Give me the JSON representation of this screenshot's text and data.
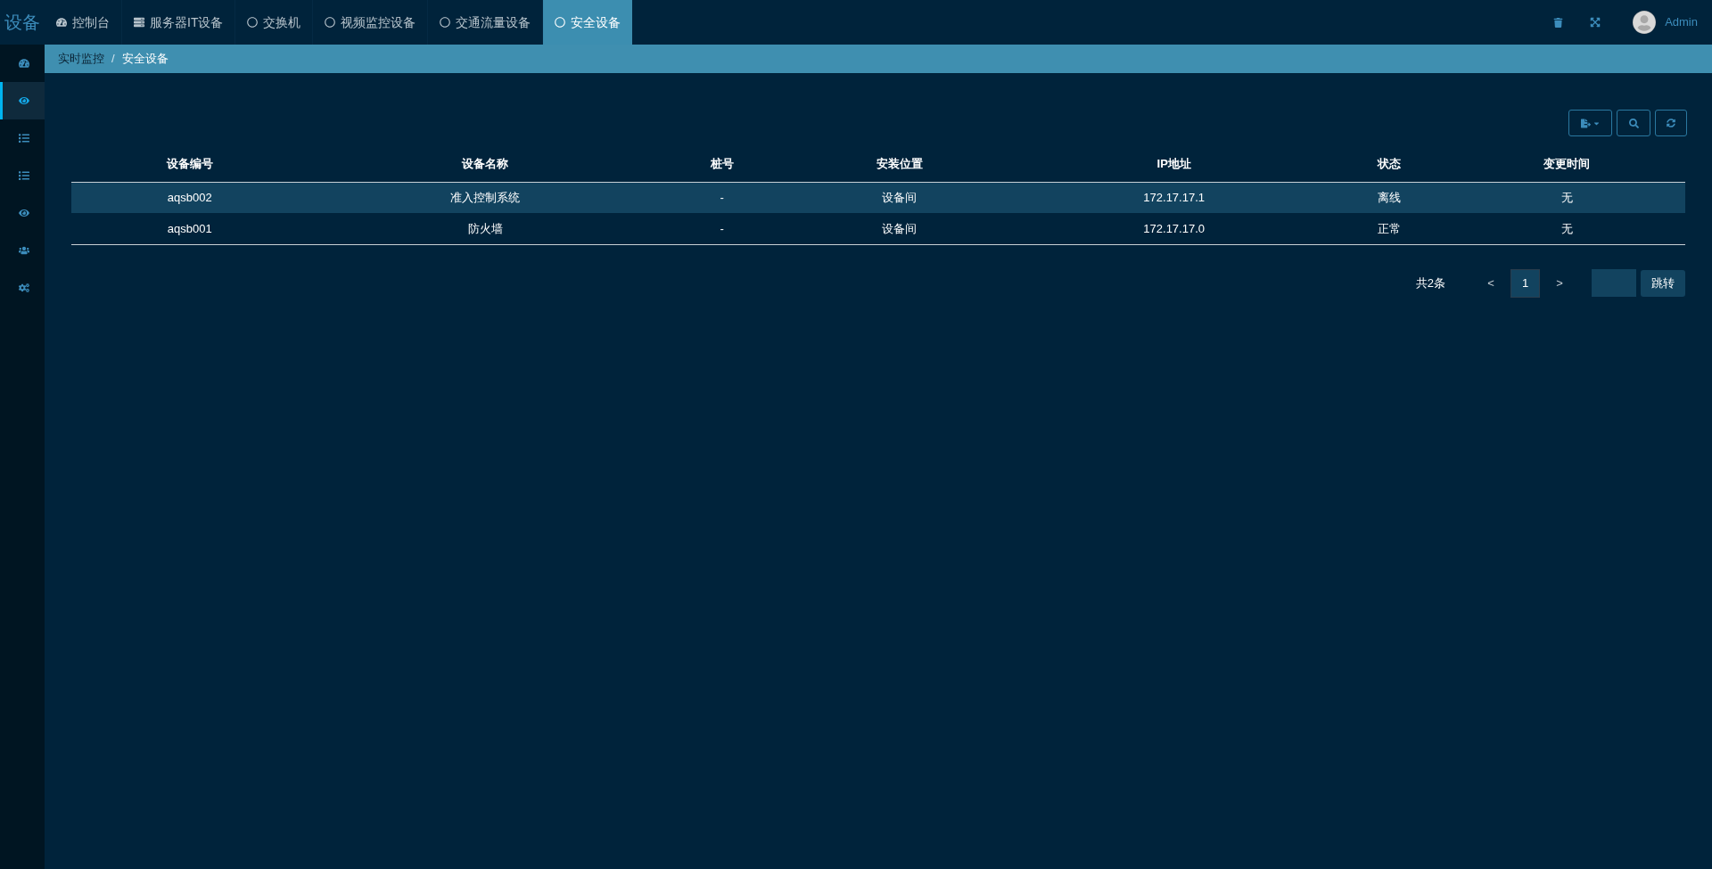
{
  "logo": "设备",
  "tabs": [
    {
      "label": "控制台",
      "kind": "dashboard",
      "selected": false
    },
    {
      "label": "服务器IT设备",
      "kind": "server",
      "selected": false
    },
    {
      "label": "交换机",
      "kind": "circle",
      "selected": false
    },
    {
      "label": "视频监控设备",
      "kind": "circle",
      "selected": false
    },
    {
      "label": "交通流量设备",
      "kind": "circle",
      "selected": false
    },
    {
      "label": "安全设备",
      "kind": "circle",
      "selected": true
    }
  ],
  "user": {
    "name": "Admin"
  },
  "sidebar": {
    "items": [
      {
        "kind": "dashboard",
        "selected": false
      },
      {
        "kind": "eye",
        "selected": true
      },
      {
        "kind": "list",
        "selected": false
      },
      {
        "kind": "list",
        "selected": false
      },
      {
        "kind": "eye",
        "selected": false
      },
      {
        "kind": "users",
        "selected": false
      },
      {
        "kind": "cogs",
        "selected": false
      }
    ]
  },
  "breadcrumb": {
    "items": [
      "实时监控",
      "安全设备"
    ],
    "separator": "/"
  },
  "table": {
    "columns": [
      "设备编号",
      "设备名称",
      "桩号",
      "安装位置",
      "IP地址",
      "状态",
      "变更时间"
    ],
    "rows": [
      {
        "selected": true,
        "cells": [
          "aqsb002",
          "准入控制系统",
          "-",
          "设备间",
          "172.17.17.1",
          "离线",
          "无"
        ]
      },
      {
        "selected": false,
        "cells": [
          "aqsb001",
          "防火墙",
          "-",
          "设备间",
          "172.17.17.0",
          "正常",
          "无"
        ]
      }
    ]
  },
  "pagination": {
    "total": "共2条",
    "prev": "<",
    "pages": [
      {
        "label": "1",
        "selected": true
      }
    ],
    "next": ">",
    "jump": "跳转"
  }
}
